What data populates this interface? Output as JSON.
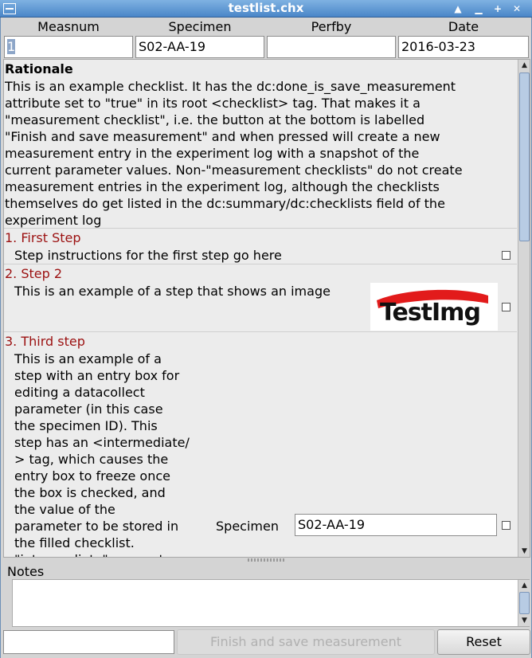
{
  "window": {
    "title": "testlist.chx"
  },
  "header": {
    "labels": [
      "Measnum",
      "Specimen",
      "Perfby",
      "Date"
    ],
    "values": {
      "measnum": "1",
      "specimen": "S02-AA-19",
      "perfby": "",
      "date": "2016-03-23"
    }
  },
  "rationale": {
    "title": "Rationale",
    "lines": [
      "This is an example checklist. It has the dc:done_is_save_measurement",
      "attribute set to \"true\" in its root <checklist> tag. That makes it a",
      "\"measurement checklist\", i.e. the button at the bottom is labelled",
      "\"Finish and save measurement\" and when pressed will create a new",
      "measurement entry in the experiment log with a snapshot of the",
      "current parameter values. Non-\"measurement checklists\" do not create",
      "measurement entries in the experiment log, although the checklists",
      "themselves do get listed in the dc:summary/dc:checklists field of the",
      "experiment log"
    ]
  },
  "steps": [
    {
      "title": "1. First Step",
      "text": "Step instructions for the first step go here"
    },
    {
      "title": "2. Step 2",
      "text": "This is an example of a step that shows an image",
      "image_text": "TestImg"
    },
    {
      "title": "3. Third step",
      "lines": [
        "This is an example of a",
        "step with an entry box for",
        "editing a datacollect",
        "parameter (in this case",
        "the specimen ID). This",
        "step has an <intermediate/",
        "> tag, which causes the",
        "entry box to freeze once",
        "the box is checked, and",
        "the value of the",
        "parameter to be stored in",
        "the filled checklist.",
        "\"intermediate\" means to"
      ],
      "param_label": "Specimen",
      "param_value": "S02-AA-19"
    }
  ],
  "notes": {
    "label": "Notes",
    "value": ""
  },
  "buttons": {
    "finish": "Finish and save measurement",
    "reset": "Reset"
  },
  "colors": {
    "step_title": "#9b1010",
    "titlebar": "#5b93cf"
  }
}
